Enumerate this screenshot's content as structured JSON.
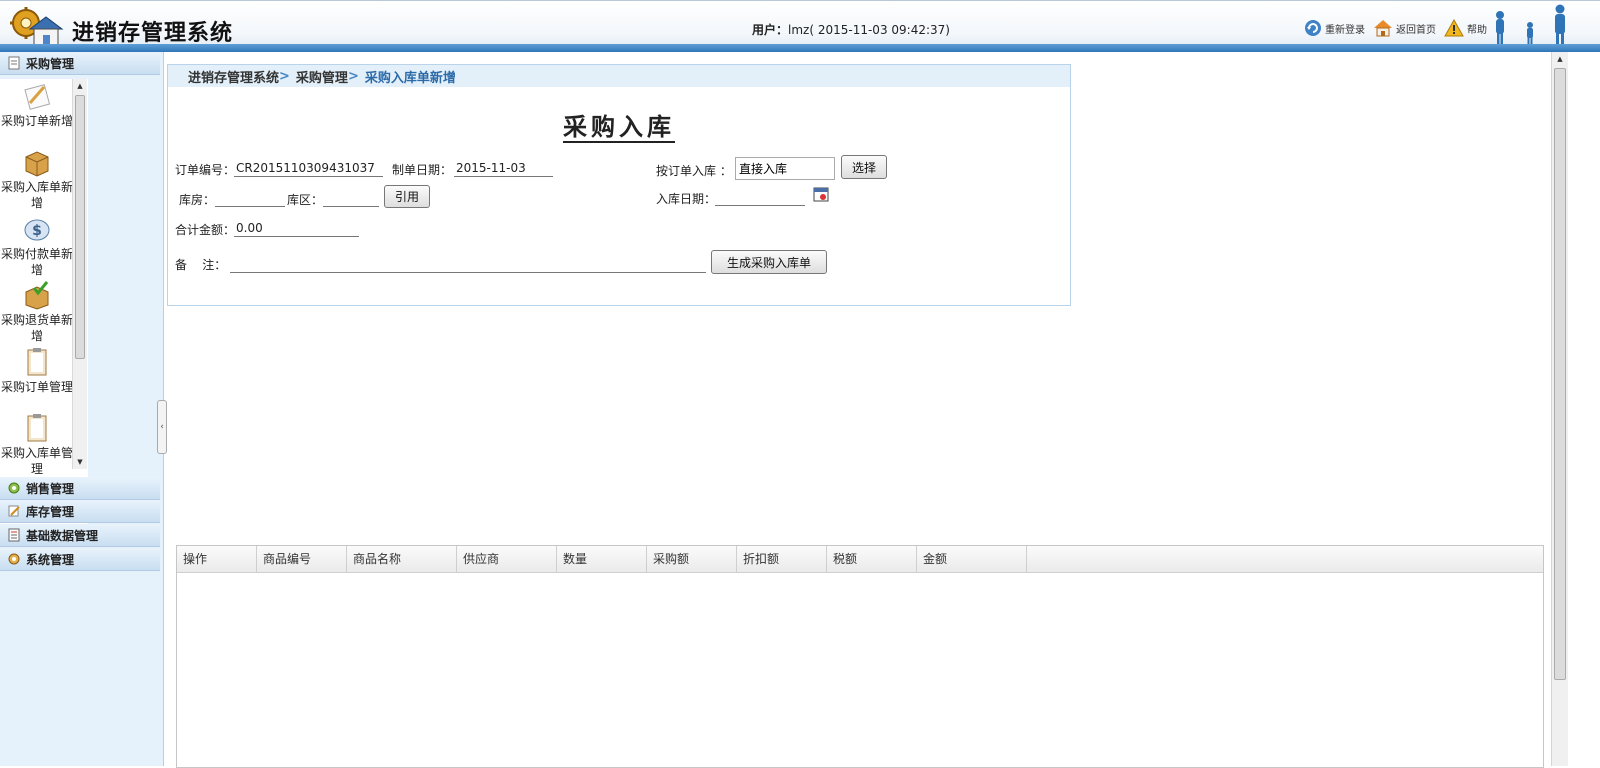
{
  "header": {
    "app_title": "进销存管理系统",
    "user_label": "用户：",
    "user_value": "lmz( 2015-11-03 09:42:37)",
    "links": [
      {
        "label": "重新登录",
        "icon": "refresh-icon"
      },
      {
        "label": "返回首页",
        "icon": "home-icon"
      },
      {
        "label": "帮助",
        "icon": "warning-icon"
      }
    ]
  },
  "sidebar": {
    "sections": [
      {
        "label": "采购管理",
        "icon": "notepad-icon"
      },
      {
        "label": "销售管理",
        "icon": "gear-chart-icon"
      },
      {
        "label": "库存管理",
        "icon": "pencil-icon"
      },
      {
        "label": "基础数据管理",
        "icon": "document-icon"
      },
      {
        "label": "系统管理",
        "icon": "gear-icon"
      }
    ],
    "items": [
      {
        "label": "采购订单新增",
        "icon": "pencil-paper-icon"
      },
      {
        "label": "采购入库单新增",
        "icon": "box-icon"
      },
      {
        "label": "采购付款单新增",
        "icon": "dollar-icon"
      },
      {
        "label": "采购退货单新增",
        "icon": "box-check-icon"
      },
      {
        "label": "采购订单管理",
        "icon": "clipboard-icon"
      },
      {
        "label": "采购入库单管理",
        "icon": "clipboard-icon"
      }
    ]
  },
  "breadcrumb": {
    "root": "进销存管理系统",
    "sep": ">",
    "parent": "采购管理",
    "current": "采购入库单新增"
  },
  "form": {
    "title": "采购入库",
    "order_no_label": "订单编号：",
    "order_no_value": "CR2015110309431037",
    "made_date_label": "制单日期：",
    "made_date_value": "2015-11-03",
    "by_order_label": "按订单入库 ：",
    "by_order_value": "直接入库",
    "select_button": "选择",
    "warehouse_label": "库房：",
    "warehouse_value": "",
    "zone_label": "库区：",
    "zone_value": "",
    "quote_button": "引用",
    "in_date_label": "入库日期：",
    "in_date_value": "",
    "total_label": "合计金额：",
    "total_value": "0.00",
    "remark_label": "备    注：",
    "remark_value": "",
    "generate_button": "生成采购入库单"
  },
  "grid": {
    "columns": [
      "操作",
      "商品编号",
      "商品名称",
      "供应商",
      "数量",
      "采购额",
      "折扣额",
      "税额",
      "金额"
    ],
    "rows": []
  },
  "colors": {
    "header_bar": "#2f76b9",
    "sidebar_bg": "#e6f2fb",
    "breadcrumb_current": "#2c6aa8"
  }
}
